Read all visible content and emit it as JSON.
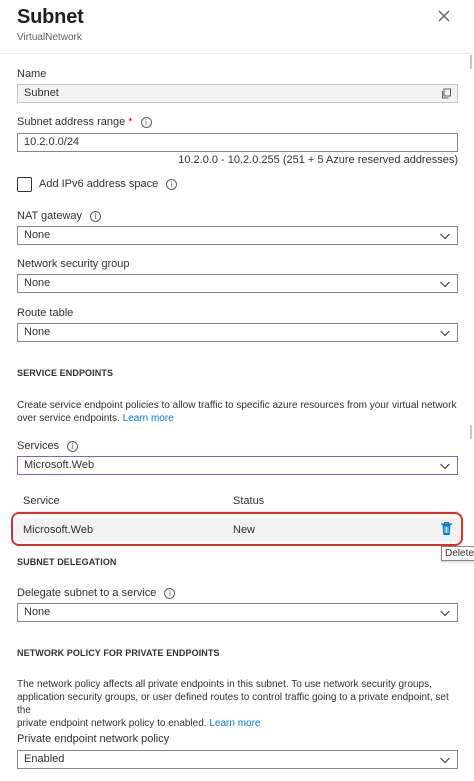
{
  "header": {
    "title": "Subnet",
    "subtitle": "VirtualNetwork"
  },
  "name": {
    "label": "Name",
    "value": "Subnet"
  },
  "address_range": {
    "label": "Subnet address range",
    "required_mark": "*",
    "value": "10.2.0.0/24",
    "hint": "10.2.0.0 - 10.2.0.255 (251 + 5 Azure reserved addresses)"
  },
  "ipv6": {
    "label": "Add IPv6 address space",
    "checked": false
  },
  "nat_gateway": {
    "label": "NAT gateway",
    "value": "None"
  },
  "nsg": {
    "label": "Network security group",
    "value": "None"
  },
  "route_table": {
    "label": "Route table",
    "value": "None"
  },
  "service_endpoints": {
    "heading": "SERVICE ENDPOINTS",
    "desc_line1": "Create service endpoint policies to allow traffic to specific azure resources from your virtual network",
    "desc_line2": "over service endpoints.",
    "learn_more": "Learn more",
    "services_label": "Services",
    "services_value": "Microsoft.Web",
    "table": {
      "headers": [
        "Service",
        "Status"
      ],
      "rows": [
        {
          "service": "Microsoft.Web",
          "status": "New"
        }
      ]
    },
    "delete_tooltip": "Delete"
  },
  "delegation": {
    "heading": "SUBNET DELEGATION",
    "label": "Delegate subnet to a service",
    "value": "None"
  },
  "network_policy": {
    "heading": "NETWORK POLICY FOR PRIVATE ENDPOINTS",
    "desc_line1": "The network policy affects all private endpoints in this subnet. To use network security groups,",
    "desc_line2": "application security groups, or user defined routes to control traffic going to a private endpoint, set the",
    "desc_line3": "private endpoint network policy to enabled.",
    "learn_more": "Learn more",
    "label": "Private endpoint network policy",
    "value": "Enabled"
  },
  "colors": {
    "link": "#0078d4",
    "highlight": "#d9302c",
    "focus_border": "#8764b8",
    "delete_icon": "#0078d4"
  }
}
